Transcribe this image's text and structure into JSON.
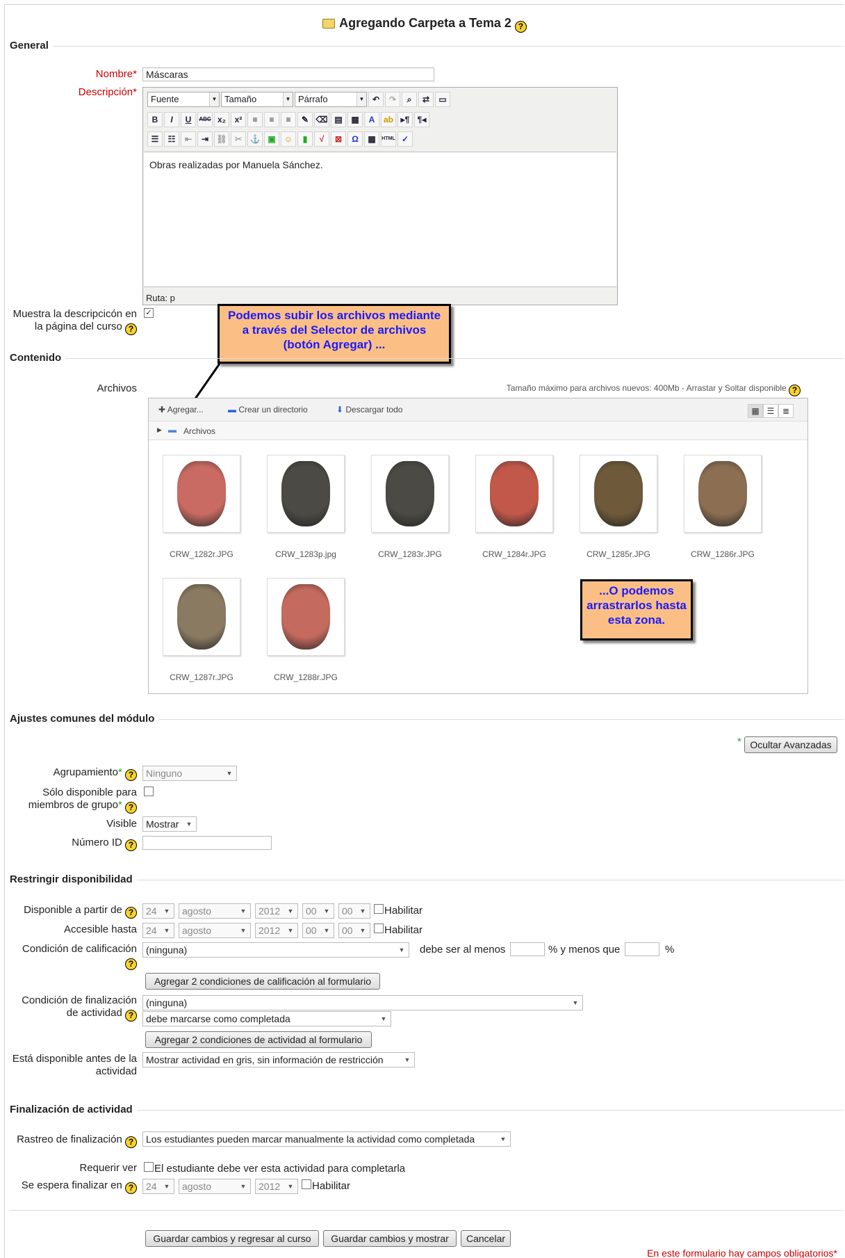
{
  "page_title": "Agregando Carpeta a Tema 2",
  "sections": {
    "general": "General",
    "contenido": "Contenido",
    "ajustes": "Ajustes comunes del módulo",
    "restringir": "Restringir disponibilidad",
    "finalizacion": "Finalización de actividad"
  },
  "general": {
    "nombre_label": "Nombre",
    "nombre_value": "Máscaras",
    "descripcion_label": "Descripción",
    "editor": {
      "font_select": "Fuente",
      "size_select": "Tamaño",
      "format_select": "Párrafo",
      "content": "Obras realizadas por Manuela Sánchez.",
      "path": "Ruta: p"
    },
    "show_desc_label_1": "Muestra la descripcicón en",
    "show_desc_label_2": "la página del curso",
    "show_desc_checked": "✓"
  },
  "callouts": {
    "upload": "Podemos subir los archivos mediante a través del Selector de archivos (botón Agregar) ...",
    "drag": "...O podemos arrastrarlos hasta esta zona."
  },
  "contenido": {
    "archivos_label": "Archivos",
    "max_size_note": "Tamaño máximo para archivos nuevos: 400Mb - Arrastar y Soltar disponible",
    "add_btn": "Agregar...",
    "mkdir_btn": "Crear un directorio",
    "download_btn": "Descargar todo",
    "path_label": "Archivos",
    "files": [
      {
        "name": "CRW_1282r.JPG",
        "color": "#c96b62"
      },
      {
        "name": "CRW_1283p.jpg",
        "color": "#4b4a44"
      },
      {
        "name": "CRW_1283r.JPG",
        "color": "#4b4a44"
      },
      {
        "name": "CRW_1284r.JPG",
        "color": "#c2584a"
      },
      {
        "name": "CRW_1285r.JPG",
        "color": "#6e5a3a"
      },
      {
        "name": "CRW_1286r.JPG",
        "color": "#8c6f52"
      },
      {
        "name": "CRW_1287r.JPG",
        "color": "#8a7a62"
      },
      {
        "name": "CRW_1288r.JPG",
        "color": "#c46a5e"
      }
    ]
  },
  "ajustes": {
    "advanced_btn": "Ocultar Avanzadas",
    "agrupamiento_label": "Agrupamiento",
    "agrupamiento_value": "Ninguno",
    "solo_label_1": "Sólo disponible para",
    "solo_label_2": "miembros de grupo",
    "visible_label": "Visible",
    "visible_value": "Mostrar",
    "numero_id_label": "Número ID"
  },
  "restringir": {
    "desde_label": "Disponible a partir de",
    "hasta_label": "Accesible hasta",
    "day": "24",
    "month": "agosto",
    "year": "2012",
    "hour": "00",
    "minute": "00",
    "habilitar": "Habilitar",
    "cond_calif_label": "Condición de calificación",
    "cond_calif_value": "(ninguna)",
    "debe_ser_al_menos": "debe ser al menos",
    "y_menos_que": "% y menos que",
    "percent": "%",
    "add_calif_btn": "Agregar 2 condiciones de calificación al formulario",
    "cond_fin_label_1": "Condición de finalización",
    "cond_fin_label_2": "de actividad",
    "cond_fin_value": "(ninguna)",
    "cond_fin_state": "debe marcarse como completada",
    "add_act_btn": "Agregar 2 condiciones de actividad al formulario",
    "antes_label_1": "Está disponible antes de la",
    "antes_label_2": "actividad",
    "antes_value": "Mostrar actividad en gris, sin información de restricción"
  },
  "finalizacion": {
    "rastreo_label": "Rastreo de finalización",
    "rastreo_value": "Los estudiantes pueden marcar manualmente la actividad como completada",
    "requerir_label": "Requerir ver",
    "requerir_text": "El estudiante debe ver esta actividad para completarla",
    "espera_label": "Se espera finalizar en",
    "day": "24",
    "month": "agosto",
    "year": "2012",
    "habilitar": "Habilitar"
  },
  "footer": {
    "save_return": "Guardar cambios y regresar al curso",
    "save_show": "Guardar cambios y mostrar",
    "cancel": "Cancelar",
    "required_note": "En este formulario hay campos obligatorios"
  },
  "icons": {
    "help": "?",
    "required": "*"
  }
}
